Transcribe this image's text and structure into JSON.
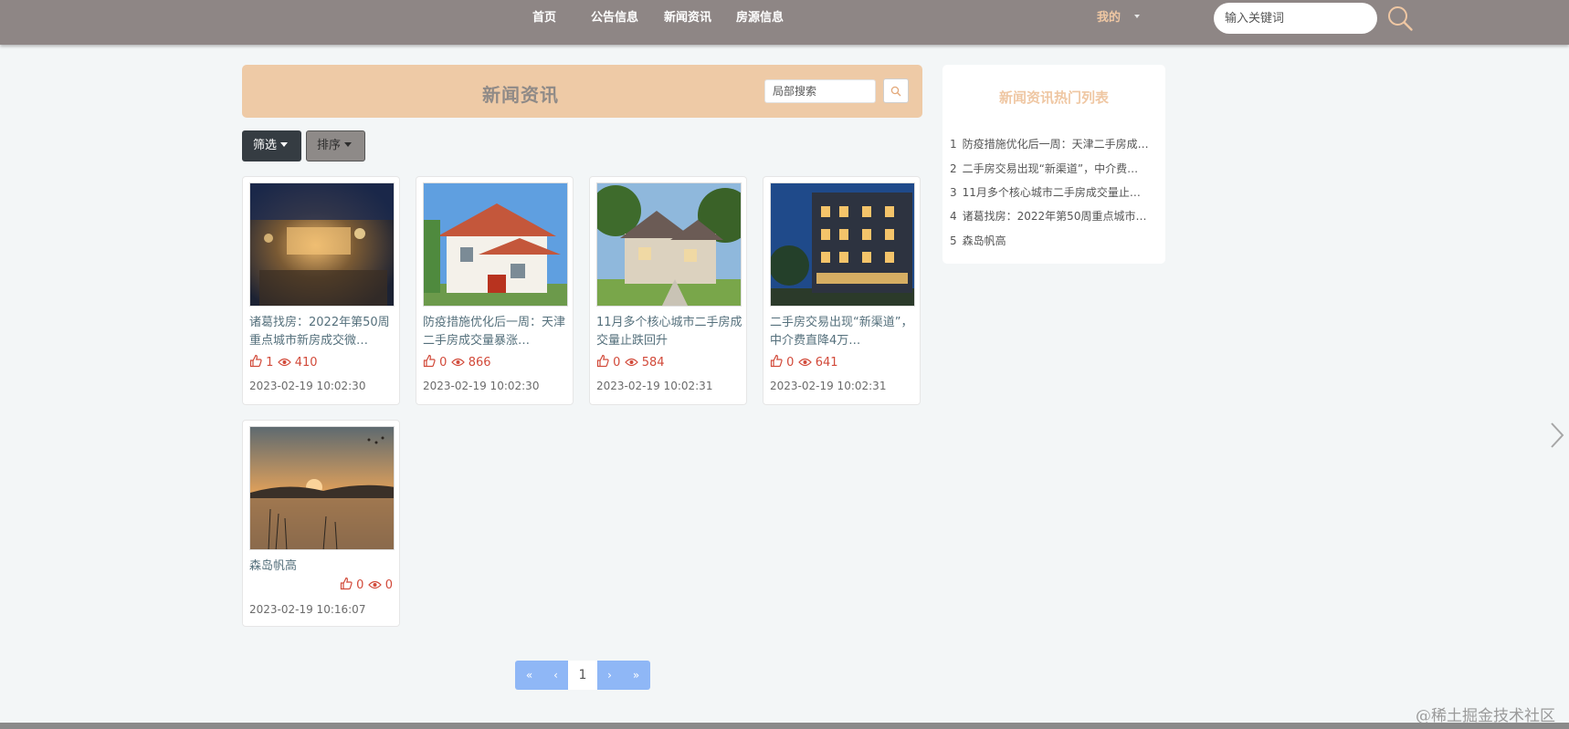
{
  "nav": {
    "links": [
      "首页",
      "公告信息",
      "新闻资讯",
      "房源信息"
    ],
    "mine_label": "我的",
    "search_placeholder": "输入关键词"
  },
  "main": {
    "header_title": "新闻资讯",
    "local_search_placeholder": "局部搜索",
    "filter_label": "筛选",
    "sort_label": "排序"
  },
  "cards": [
    {
      "title": "诸葛找房：2022年第50周重点城市新房成交微…",
      "likes": "1",
      "views": "410",
      "date": "2023-02-19 10:02:30"
    },
    {
      "title": "防疫措施优化后一周：天津二手房成交量暴涨…",
      "likes": "0",
      "views": "866",
      "date": "2023-02-19 10:02:30"
    },
    {
      "title": "11月多个核心城市二手房成交量止跌回升",
      "likes": "0",
      "views": "584",
      "date": "2023-02-19 10:02:31"
    },
    {
      "title": "二手房交易出现“新渠道”，中介费直降4万…",
      "likes": "0",
      "views": "641",
      "date": "2023-02-19 10:02:31"
    },
    {
      "title": "森岛帆高",
      "likes": "0",
      "views": "0",
      "date": "2023-02-19 10:16:07"
    }
  ],
  "pagination": {
    "first": "«",
    "prev": "‹",
    "current": "1",
    "next": "›",
    "last": "»"
  },
  "hot": {
    "title": "新闻资讯热门列表",
    "items": [
      {
        "num": "1",
        "text": "防疫措施优化后一周：天津二手房成…"
      },
      {
        "num": "2",
        "text": "二手房交易出现“新渠道”，中介费…"
      },
      {
        "num": "3",
        "text": "11月多个核心城市二手房成交量止…"
      },
      {
        "num": "4",
        "text": "诸葛找房：2022年第50周重点城市…"
      },
      {
        "num": "5",
        "text": "森岛帆高"
      }
    ]
  },
  "watermark": "@稀土掘金技术社区",
  "colors": {
    "nav_bg": "#8e8685",
    "accent": "#eecaa6",
    "stat_red": "#d24a3a",
    "pager_blue": "#8fb7f6"
  }
}
